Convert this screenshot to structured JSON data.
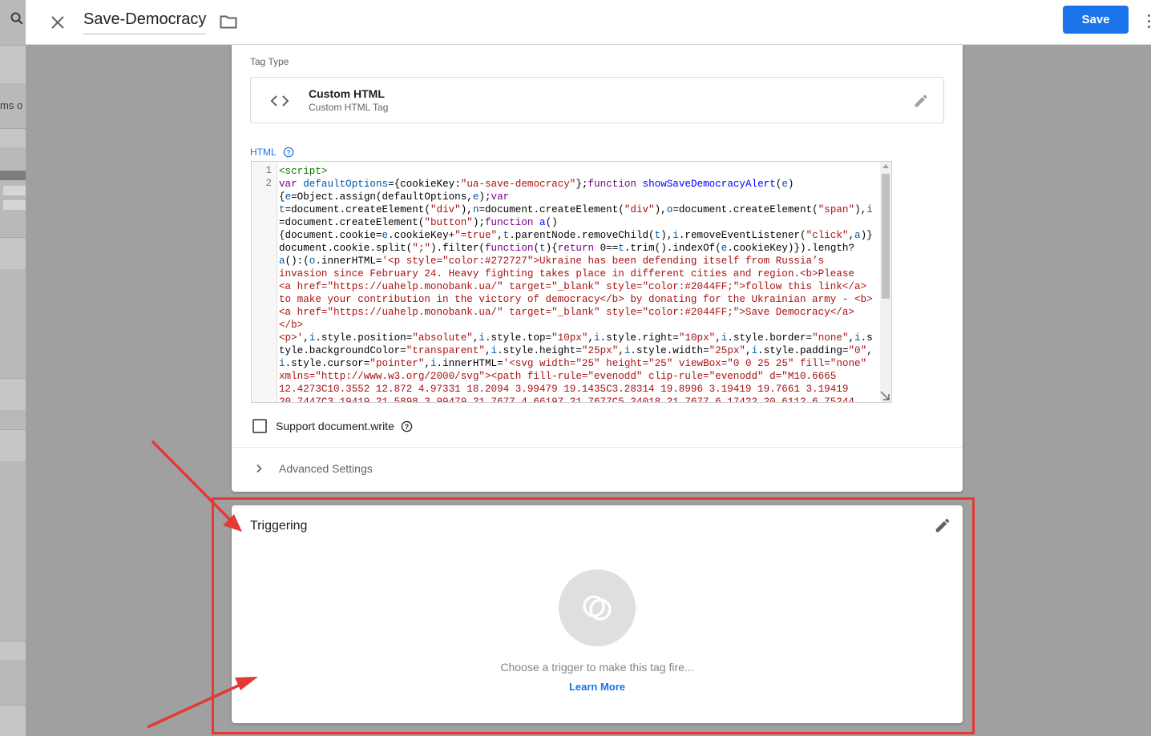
{
  "header": {
    "tag_name": "Save-Democracy",
    "save_label": "Save"
  },
  "config": {
    "tag_type_label": "Tag Type",
    "tag_type_title": "Custom HTML",
    "tag_type_subtitle": "Custom HTML Tag",
    "html_label": "HTML",
    "line_numbers": [
      "1",
      "2"
    ],
    "support_label": "Support document.write",
    "support_checked": false,
    "advanced_label": "Advanced Settings"
  },
  "trigger": {
    "title": "Triggering",
    "hint": "Choose a trigger to make this tag fire...",
    "learn_more": "Learn More"
  },
  "background": {
    "partial_text": "ms o"
  },
  "colors": {
    "accent": "#1a73e8",
    "highlight": "#e53935"
  }
}
